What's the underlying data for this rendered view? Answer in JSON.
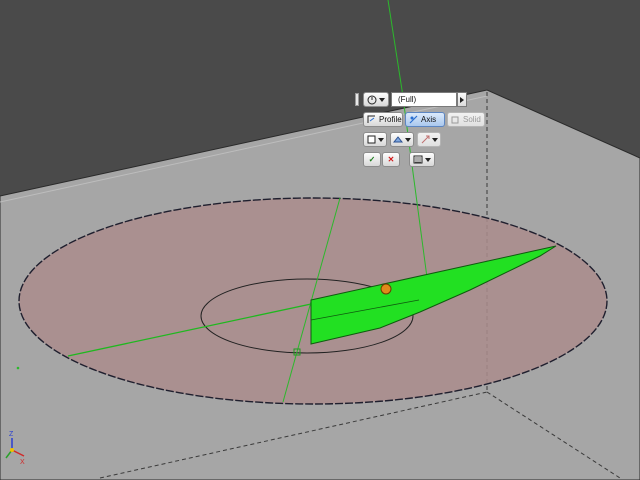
{
  "toolbar": {
    "selection_value": "(Full)",
    "profile_label": "Profile",
    "axis_label": "Axis",
    "solid_label": "Solid",
    "ok_glyph": "✓",
    "cancel_glyph": "✕"
  },
  "triad": {
    "z_label": "Z",
    "x_label": "X"
  },
  "colors": {
    "plane": "#a6a6a6",
    "ellipse_fill": "#aa8c8c",
    "profile_green": "#22e022",
    "axis_green": "#2cb82c",
    "active_blue": "#aac8ee"
  },
  "icons": [
    "rotation-icon",
    "profile-icon",
    "axis-icon",
    "solid-icon",
    "output-solid-icon",
    "output-surface-icon",
    "flip-icon",
    "ok-icon",
    "cancel-icon",
    "options-icon",
    "coordinate-triad-icon",
    "constraint-icon"
  ]
}
